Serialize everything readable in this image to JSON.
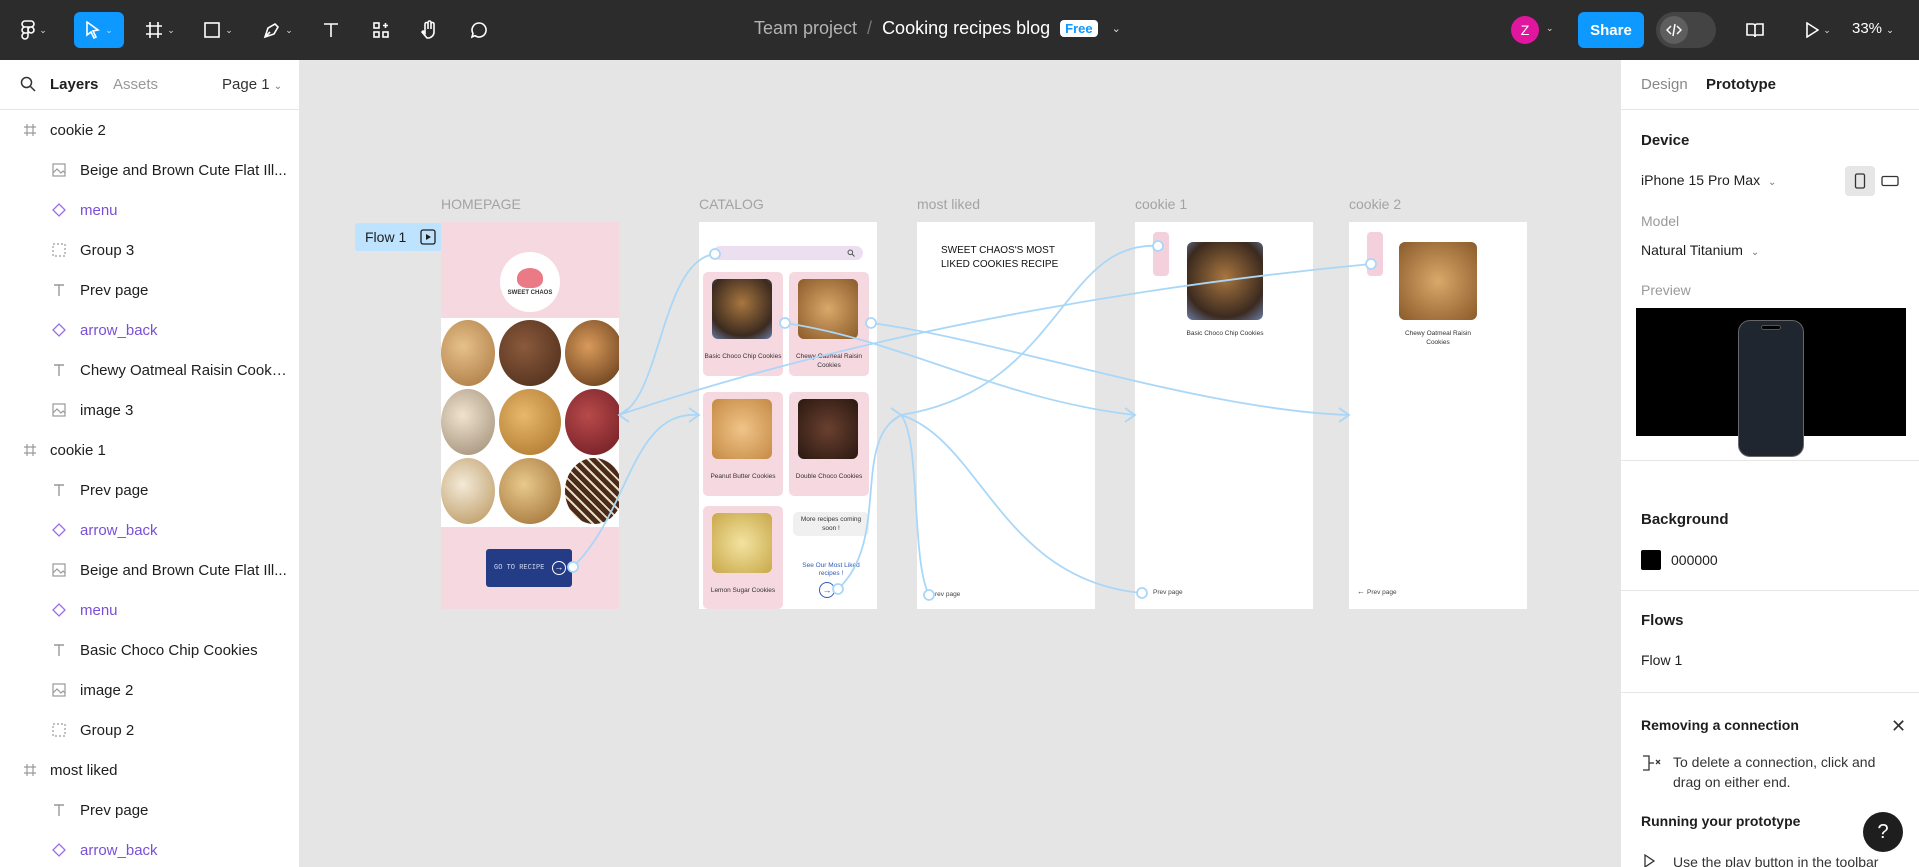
{
  "topbar": {
    "team": "Team project",
    "separator": "/",
    "file_name": "Cooking recipes blog",
    "plan_badge": "Free",
    "avatar_initial": "Z",
    "share_label": "Share",
    "zoom_level": "33%",
    "tools": [
      "main-menu-icon",
      "move-icon",
      "frame-icon",
      "shape-icon",
      "pen-icon",
      "text-icon",
      "resources-icon",
      "hand-icon",
      "comment-icon"
    ],
    "accent": "#0d99ff"
  },
  "left_panel": {
    "tab_layers": "Layers",
    "tab_assets": "Assets",
    "page": "Page 1",
    "layers": [
      {
        "type": "frame",
        "label": "cookie 2"
      },
      {
        "type": "image",
        "label": "Beige and Brown Cute Flat Ill..."
      },
      {
        "type": "component",
        "label": "menu"
      },
      {
        "type": "group",
        "label": "Group 3"
      },
      {
        "type": "text",
        "label": "Prev page"
      },
      {
        "type": "component",
        "label": "arrow_back"
      },
      {
        "type": "text",
        "label": "Chewy Oatmeal Raisin Cookies"
      },
      {
        "type": "image",
        "label": "image 3"
      },
      {
        "type": "frame",
        "label": "cookie 1"
      },
      {
        "type": "text",
        "label": "Prev page"
      },
      {
        "type": "component",
        "label": "arrow_back"
      },
      {
        "type": "image",
        "label": "Beige and Brown Cute Flat Ill..."
      },
      {
        "type": "component",
        "label": "menu"
      },
      {
        "type": "text",
        "label": "Basic Choco Chip Cookies"
      },
      {
        "type": "image",
        "label": "image 2"
      },
      {
        "type": "group",
        "label": "Group 2"
      },
      {
        "type": "frame",
        "label": "most liked"
      },
      {
        "type": "text",
        "label": "Prev page"
      },
      {
        "type": "component",
        "label": "arrow_back"
      }
    ]
  },
  "canvas": {
    "flow_chip": "Flow 1",
    "frames": {
      "homepage": "HOMEPAGE",
      "catalog": "CATALOG",
      "most_liked": "most liked",
      "cookie1": "cookie 1",
      "cookie2": "cookie 2"
    },
    "homepage": {
      "logo_text": "SWEET CHAOS",
      "go_button": "GO TO RECIPE"
    },
    "catalog": {
      "cards": [
        "Basic Choco Chip Cookies",
        "Chewy Oatmeal Raisin Cookies",
        "Peanut Butter Cookies",
        "Double Choco Cookies",
        "Lemon Sugar Cookies"
      ],
      "more_note": "More recipes coming soon !",
      "liked_link": "See Our Most Liked recipes !"
    },
    "most_liked": {
      "title": "SWEET CHAOS'S MOST LIKED COOKIES RECIPE",
      "prev": "rev page"
    },
    "cookie1": {
      "caption": "Basic Choco Chip Cookies",
      "prev": "Prev page"
    },
    "cookie2": {
      "caption": "Chewy Oatmeal Raisin Cookies",
      "prev": "Prev page"
    }
  },
  "right_panel": {
    "tab_design": "Design",
    "tab_prototype": "Prototype",
    "device_heading": "Device",
    "device": "iPhone 15 Pro Max",
    "model_label": "Model",
    "model": "Natural Titanium",
    "preview_label": "Preview",
    "background_heading": "Background",
    "background_hex": "000000",
    "flows_heading": "Flows",
    "flow_item": "Flow 1",
    "tip1_title": "Removing a connection",
    "tip1_body": "To delete a connection, click and drag on either end.",
    "tip2_title": "Running your prototype",
    "tip2_body": "Use the play button in the toolbar",
    "help": "?"
  }
}
